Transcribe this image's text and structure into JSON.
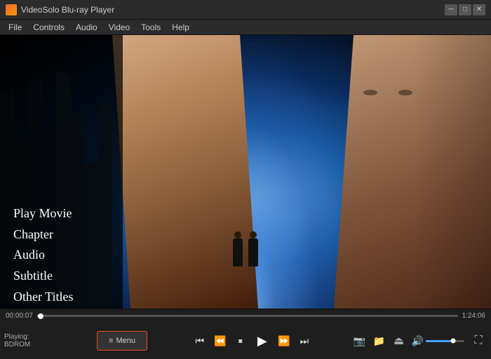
{
  "app": {
    "title": "VideoSolo Blu-ray Player"
  },
  "titlebar": {
    "logo_color": "#e06030",
    "minimize_label": "─",
    "restore_label": "□",
    "close_label": "✕"
  },
  "menubar": {
    "items": [
      "File",
      "Controls",
      "Audio",
      "Video",
      "Tools",
      "Help"
    ]
  },
  "context_menu": {
    "options": [
      "Play Movie",
      "Chapter",
      "Audio",
      "Subtitle",
      "Other Titles"
    ]
  },
  "progress": {
    "time_left": "00:00:07",
    "time_right": "1:24:06",
    "fill_percent": 0.8
  },
  "controls": {
    "playing_label": "Playing:",
    "playing_value": "BDROM",
    "menu_icon": "≡",
    "menu_label": "Menu"
  },
  "transport": {
    "skip_back": "⏮",
    "rewind": "⏪",
    "stop": "⏹",
    "play": "▶",
    "fast_forward": "⏩",
    "skip_forward": "⏭"
  },
  "right_icons": {
    "screenshot": "📷",
    "folder": "📁",
    "eject": "⏏"
  },
  "volume": {
    "icon": "🔊",
    "level": 70
  }
}
